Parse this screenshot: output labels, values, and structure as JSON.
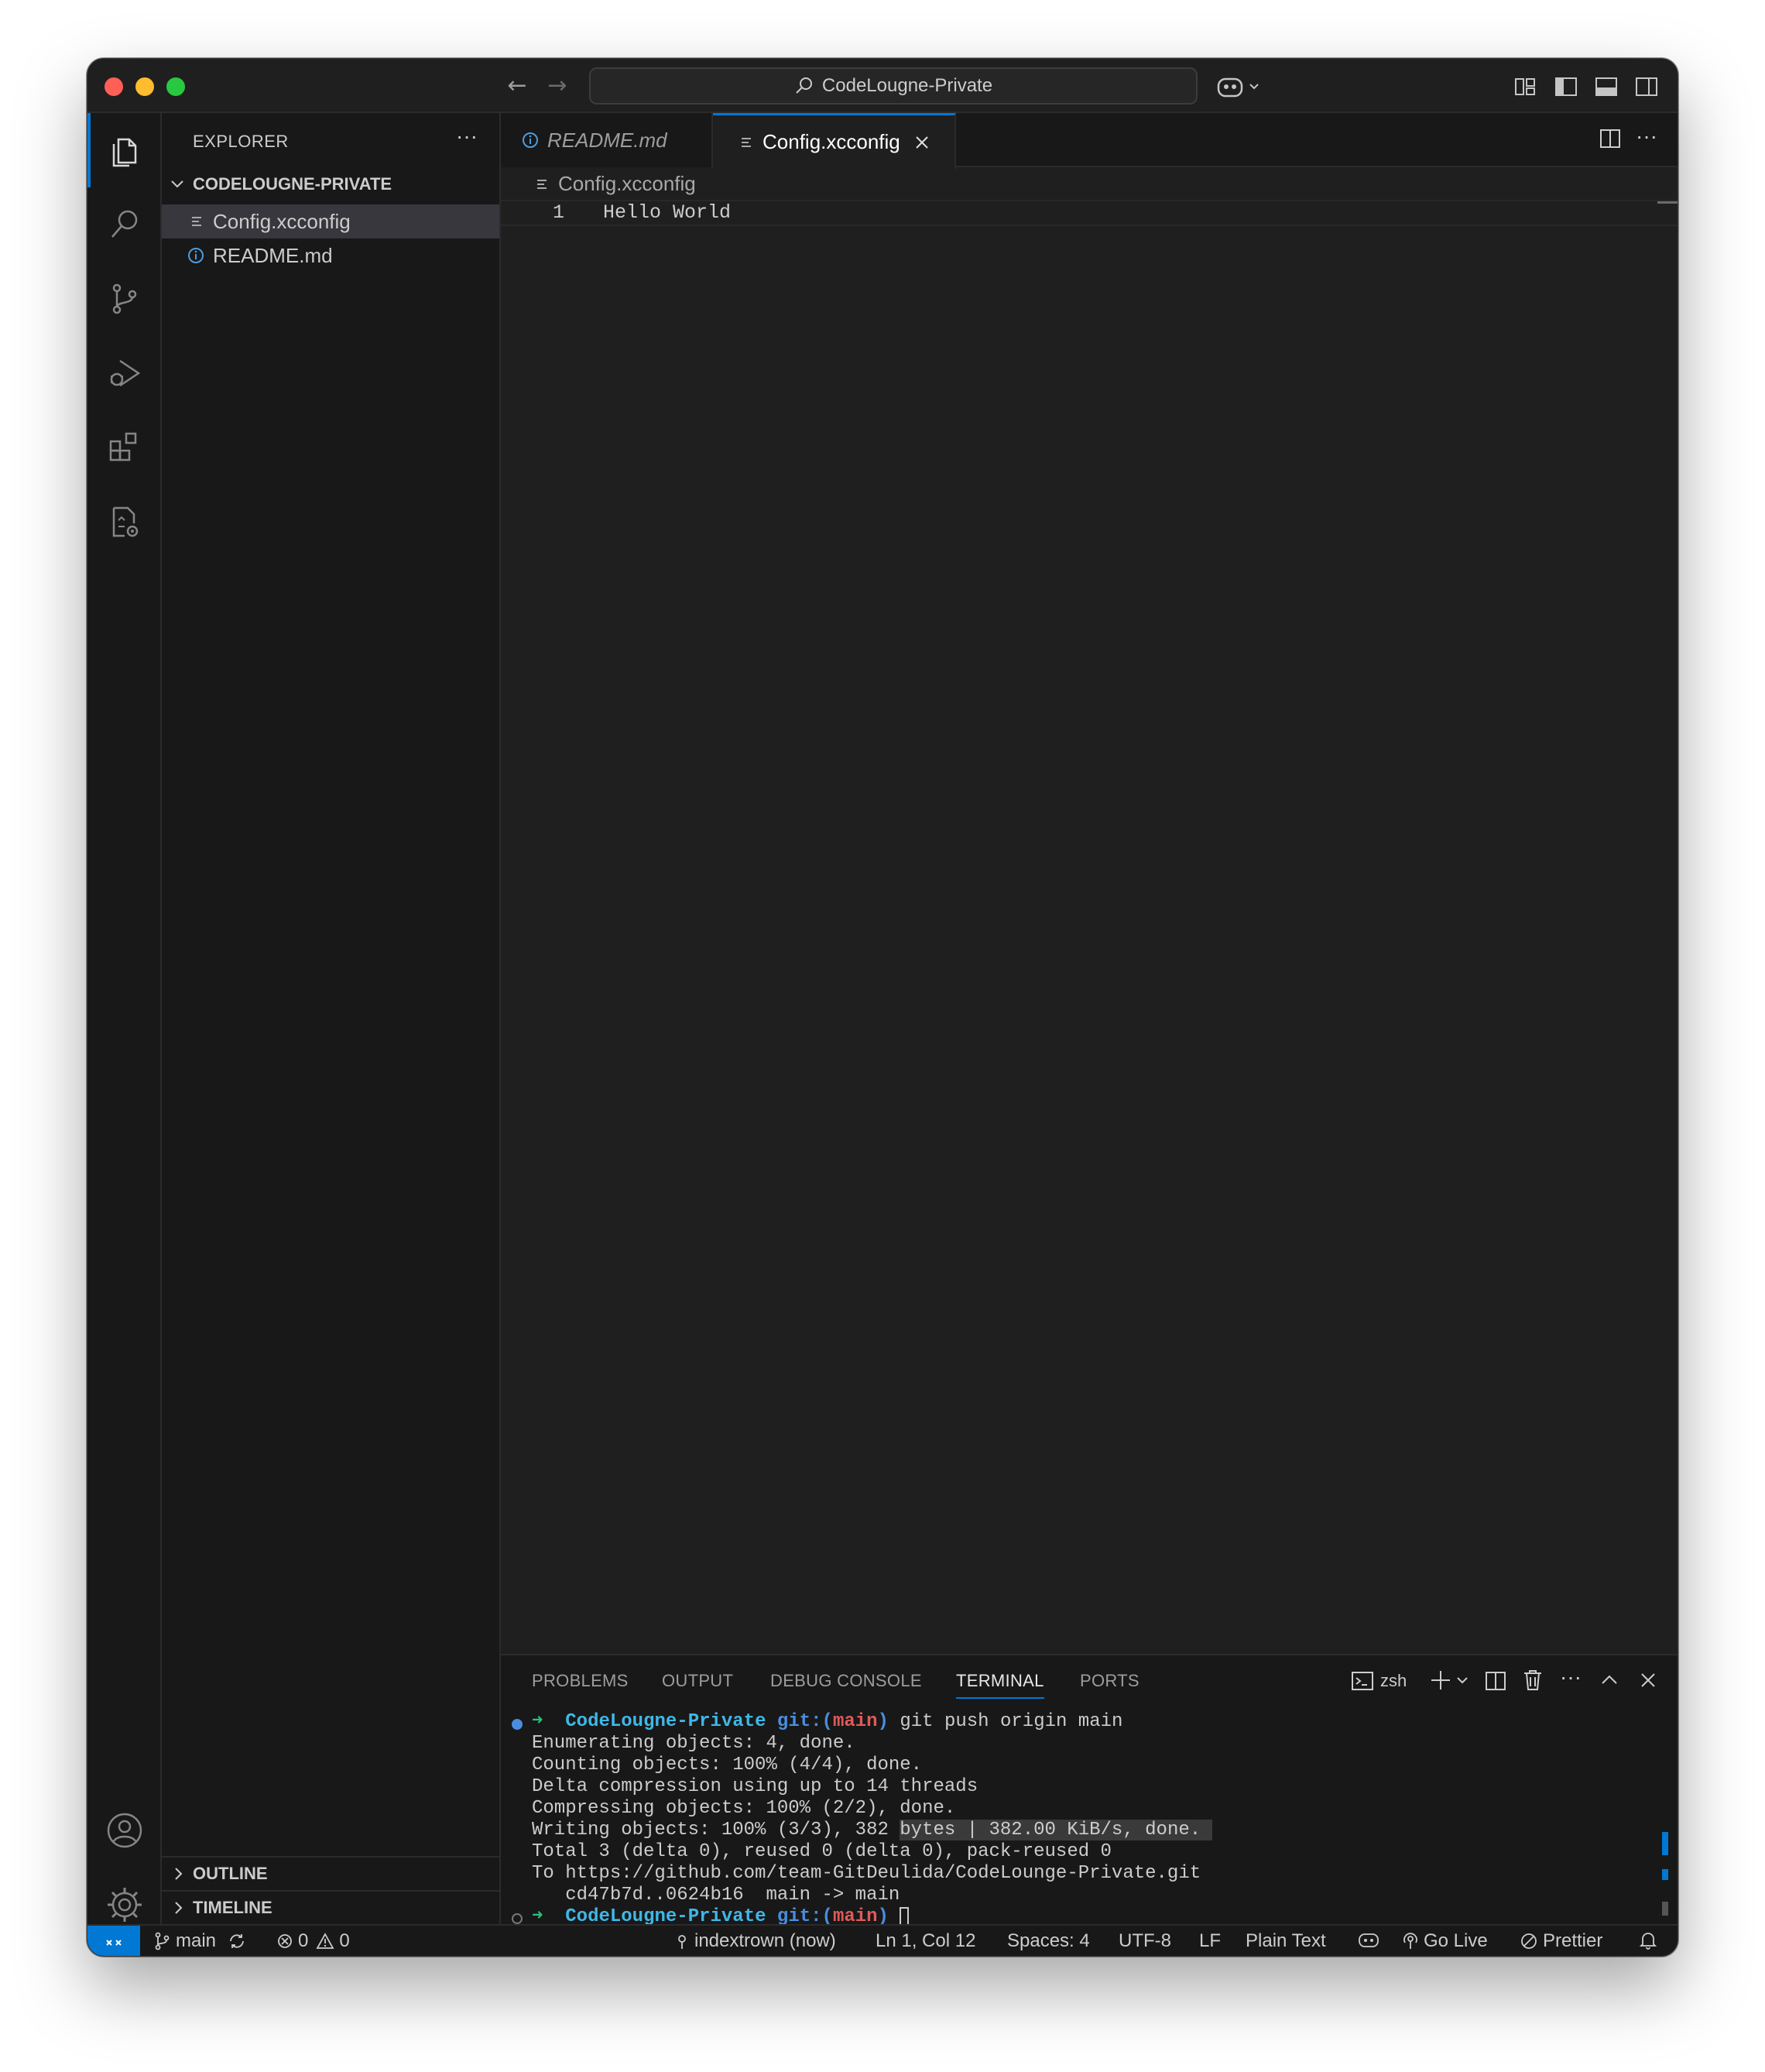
{
  "titlebar": {
    "back": "←",
    "forward": "→",
    "search_text": "CodeLougne-Private"
  },
  "sidebar": {
    "title": "EXPLORER",
    "more": "···",
    "folder": "CODELOUGNE-PRIVATE",
    "files": [
      {
        "name": "Config.xcconfig",
        "icon": "lines-file-icon",
        "selected": true
      },
      {
        "name": "README.md",
        "icon": "info-file-icon",
        "selected": false
      }
    ],
    "outline": "OUTLINE",
    "timeline": "TIMELINE"
  },
  "editor": {
    "tabs": [
      {
        "label": "README.md",
        "active": false
      },
      {
        "label": "Config.xcconfig",
        "active": true
      }
    ],
    "breadcrumb": "Config.xcconfig",
    "lines": [
      {
        "number": "1",
        "text": "Hello World"
      }
    ]
  },
  "panel": {
    "tabs": [
      "PROBLEMS",
      "OUTPUT",
      "DEBUG CONSOLE",
      "TERMINAL",
      "PORTS"
    ],
    "active_tab": "TERMINAL",
    "shell": "zsh",
    "terminal": {
      "prompt_dir": "CodeLougne-Private",
      "git_label": "git:(",
      "branch": "main",
      "git_close": ")",
      "command": "git push origin main",
      "output": [
        "Enumerating objects: 4, done.",
        "Counting objects: 100% (4/4), done.",
        "Delta compression using up to 14 threads",
        "Compressing objects: 100% (2/2), done."
      ],
      "writing_a": "Writing objects: 100% (3/3), 382 ",
      "writing_b": "bytes | 382.00 KiB/s, done. ",
      "output2": [
        "Total 3 (delta 0), reused 0 (delta 0), pack-reused 0",
        "To https://github.com/team-GitDeulida/CodeLounge-Private.git",
        "   cd47b7d..0624b16  main -> main"
      ]
    }
  },
  "statusbar": {
    "branch": "main",
    "errors": "0",
    "warnings": "0",
    "commit_info": "indextrown (now)",
    "position": "Ln 1, Col 12",
    "spaces": "Spaces: 4",
    "encoding": "UTF-8",
    "eol": "LF",
    "language": "Plain Text",
    "go_live": "Go Live",
    "prettier": "Prettier"
  },
  "colors": {
    "accent": "#0078d4",
    "editor_bg": "#1f1f1f",
    "sidebar_bg": "#181818"
  }
}
